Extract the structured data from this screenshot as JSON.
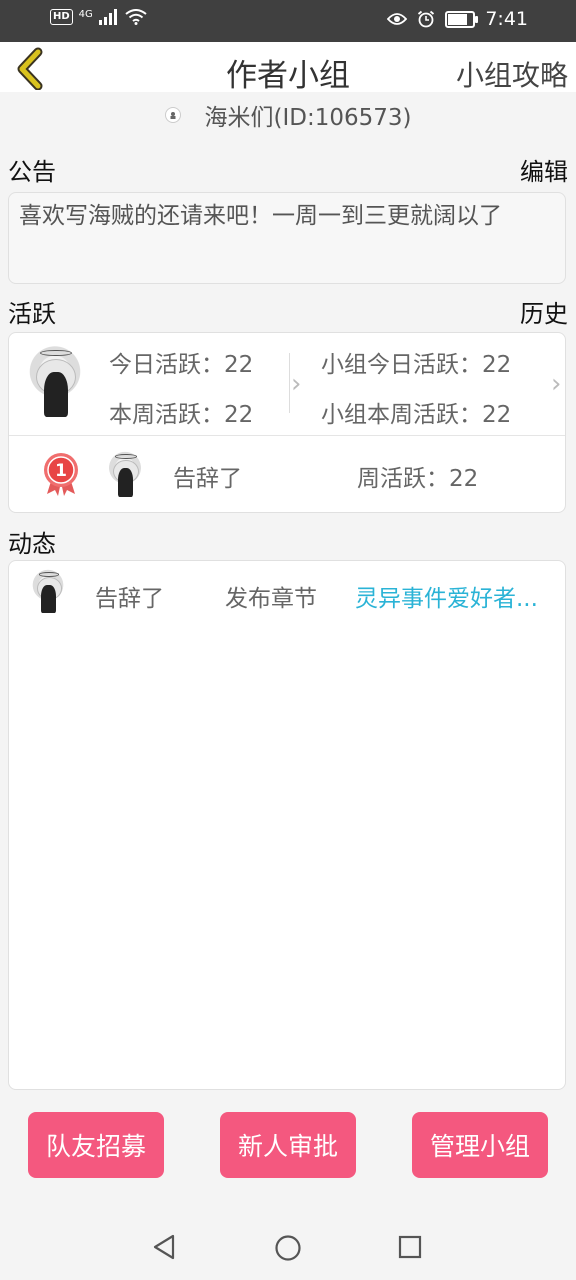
{
  "status_bar": {
    "hd": "HD",
    "network": "4G",
    "time": "7:41",
    "battery_level": 0.8
  },
  "header": {
    "title": "作者小组",
    "right_link": "小组攻略"
  },
  "group": {
    "name_id": "海米们(ID:106573)"
  },
  "announcement": {
    "label": "公告",
    "edit": "编辑",
    "text": "喜欢写海贼的还请来吧！一周一到三更就阔以了"
  },
  "activity": {
    "label": "活跃",
    "history": "历史",
    "today": "今日活跃：22",
    "week": "本周活跃：22",
    "group_today": "小组今日活跃：22",
    "group_week": "小组本周活跃：22",
    "rank": "1",
    "top_member": "告辞了",
    "top_week": "周活跃：22"
  },
  "feed": {
    "label": "动态",
    "items": [
      {
        "user": "告辞了",
        "action": "发布章节",
        "target": "灵异事件爱好者..."
      }
    ]
  },
  "buttons": {
    "recruit": "队友招募",
    "approve": "新人审批",
    "manage": "管理小组"
  },
  "colors": {
    "accent": "#f4587f",
    "link": "#2ab3d6",
    "back_arrow": "#d9c21e"
  }
}
